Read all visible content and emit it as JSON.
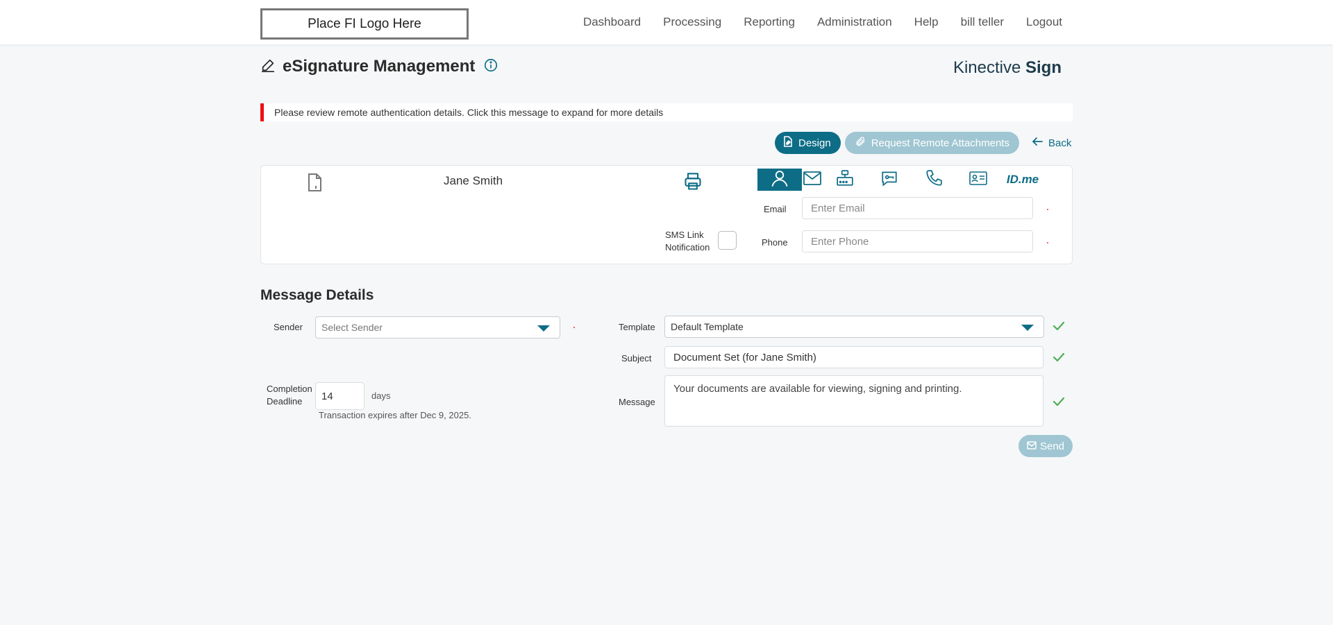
{
  "header": {
    "logo_text": "Place FI Logo Here",
    "nav": [
      {
        "label": "Dashboard"
      },
      {
        "label": "Processing"
      },
      {
        "label": "Reporting"
      },
      {
        "label": "Administration"
      },
      {
        "label": "Help"
      },
      {
        "label": "bill teller"
      },
      {
        "label": "Logout"
      }
    ]
  },
  "page": {
    "title": "eSignature Management",
    "title_icon": "pen-icon",
    "info_icon": "info-icon",
    "brand_light": "Kinective ",
    "brand_bold": "Sign"
  },
  "alert": {
    "text": "Please review remote authentication details. Click this message to expand for more details",
    "color": "#ee1111"
  },
  "actions": {
    "design_label": "Design",
    "request_label": "Request Remote Attachments",
    "back_label": "Back"
  },
  "signer": {
    "name": "Jane Smith",
    "auth_icons": [
      "person-icon",
      "envelope-icon",
      "router-icon",
      "chat-key-icon",
      "phone-icon",
      "id-card-icon",
      "idme-icon"
    ],
    "idme_label": "ID.me",
    "email_label": "Email",
    "email_placeholder": "Enter Email",
    "sms_label_line1": "SMS Link",
    "sms_label_line2": "Notification",
    "phone_label": "Phone",
    "phone_placeholder": "Enter Phone"
  },
  "message_details": {
    "title": "Message Details",
    "sender_label": "Sender",
    "sender_placeholder": "Select Sender",
    "template_label": "Template",
    "template_value": "Default Template",
    "subject_label": "Subject",
    "subject_value": "Document Set (for Jane Smith)",
    "message_label": "Message",
    "message_value": "Your documents are available for viewing, signing and printing.",
    "deadline_label_line1": "Completion",
    "deadline_label_line2": "Deadline",
    "deadline_value": "14",
    "deadline_unit": "days",
    "expiry_text": "Transaction expires after Dec 9, 2025.",
    "send_label": "Send"
  },
  "colors": {
    "accent": "#0e6d86",
    "accent_disabled": "#9fc6d2",
    "check": "#4caf50",
    "alert": "#ee1111"
  }
}
